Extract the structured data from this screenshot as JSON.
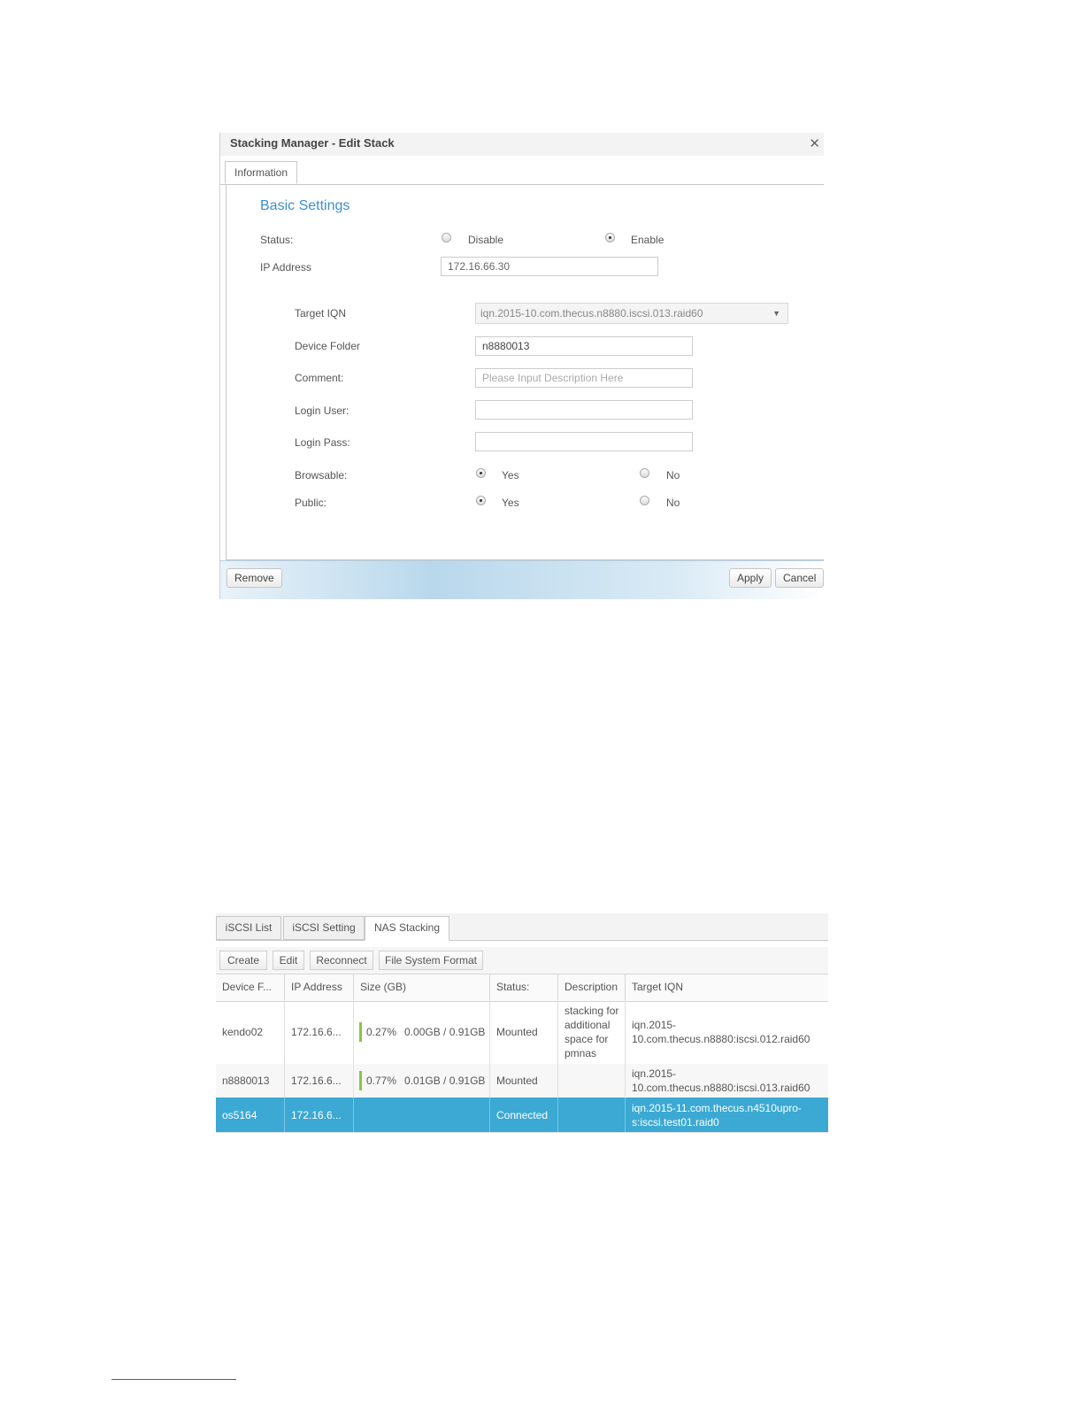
{
  "dialog": {
    "title": "Stacking Manager - Edit Stack",
    "close_icon": "close-icon",
    "tab": "Information",
    "section_title": "Basic Settings",
    "status": {
      "label": "Status:",
      "disable": "Disable",
      "enable": "Enable",
      "selected": "Enable"
    },
    "ip_address": {
      "label": "IP Address",
      "value": "172.16.66.30"
    },
    "target_iqn": {
      "label": "Target IQN",
      "value": "iqn.2015-10.com.thecus.n8880.iscsi.013.raid60"
    },
    "device_folder": {
      "label": "Device Folder",
      "value": "n8880013"
    },
    "comment": {
      "label": "Comment:",
      "placeholder": "Please Input Description Here"
    },
    "login_user": {
      "label": "Login User:",
      "value": ""
    },
    "login_pass": {
      "label": "Login Pass:",
      "value": ""
    },
    "browsable": {
      "label": "Browsable:",
      "yes": "Yes",
      "no": "No",
      "selected": "Yes"
    },
    "public": {
      "label": "Public:",
      "yes": "Yes",
      "no": "No",
      "selected": "Yes"
    },
    "buttons": {
      "remove": "Remove",
      "apply": "Apply",
      "cancel": "Cancel"
    }
  },
  "panel": {
    "tabs": [
      "iSCSI List",
      "iSCSI Setting",
      "NAS Stacking"
    ],
    "active_tab": "NAS Stacking",
    "toolbar": [
      "Create",
      "Edit",
      "Reconnect",
      "File System Format"
    ],
    "columns": [
      "Device F...",
      "IP Address",
      "Size (GB)",
      "Status:",
      "Description",
      "Target IQN"
    ],
    "rows": [
      {
        "device": "kendo02",
        "ip": "172.16.6...",
        "usage_percent": 0.27,
        "percent": "0.27%",
        "size": "0.00GB / 0.91GB",
        "status": "Mounted",
        "description": "stacking for additional space for pmnas",
        "iqn": "iqn.2015-10.com.thecus.n8880:iscsi.012.raid60"
      },
      {
        "device": "n8880013",
        "ip": "172.16.6...",
        "usage_percent": 0.77,
        "percent": "0.77%",
        "size": "0.01GB / 0.91GB",
        "status": "Mounted",
        "description": "",
        "iqn": "iqn.2015-10.com.thecus.n8880:iscsi.013.raid60"
      },
      {
        "device": "os5164",
        "ip": "172.16.6...",
        "percent": "",
        "size": "",
        "status": "Connected",
        "description": "",
        "iqn": "iqn.2015-11.com.thecus.n4510upro-s:iscsi.test01.raid0",
        "selected": true
      }
    ]
  },
  "colors": {
    "accent": "#3c8fd0",
    "selected_row": "#3ba9d3",
    "usage_bar": "#8bc53f"
  }
}
